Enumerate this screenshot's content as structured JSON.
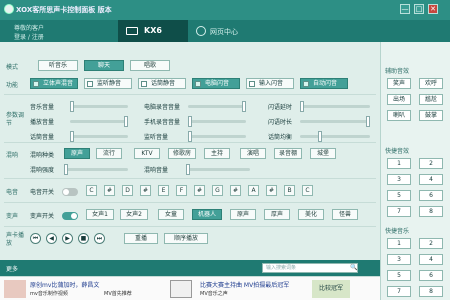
{
  "window": {
    "title": "XOX客所思声卡控制面板 版本",
    "min": "—",
    "max": "□",
    "close": "✕"
  },
  "user": {
    "line1": "尊敬的客户",
    "line2": "登录 / 注册"
  },
  "tabs": {
    "device": "KX6",
    "center": "网页中心"
  },
  "mode": {
    "label": "模式",
    "options": [
      "听音乐",
      "聊天",
      "唱歌"
    ],
    "active": 1
  },
  "function": {
    "label": "功能",
    "items": [
      {
        "label": "立体声混音",
        "on": true
      },
      {
        "label": "监听静音",
        "on": false
      },
      {
        "label": "话筒静音",
        "on": false
      },
      {
        "label": "电脑闪音",
        "on": true
      },
      {
        "label": "输入闪音",
        "on": false
      },
      {
        "label": "自动闪音",
        "on": true
      }
    ]
  },
  "params": {
    "label": "参数调节",
    "rows": [
      {
        "a": "音乐音量",
        "b": "电脑录音音量",
        "c": "闪语延时"
      },
      {
        "a": "播放音量",
        "b": "手机录音音量",
        "c": "闪语时长"
      },
      {
        "a": "话筒音量",
        "b": "监听音量",
        "c": "话筒均衡"
      }
    ]
  },
  "reverb": {
    "label": "混响",
    "type_label": "混响种类",
    "types": [
      "原声",
      "流行",
      "KTV",
      "修歌房",
      "主持",
      "演唱",
      "录音棚",
      "城堡"
    ],
    "active": 0,
    "strength_label": "混响强度",
    "eq_label": "混响音量"
  },
  "electric": {
    "label": "电音",
    "switch_label": "电音开关",
    "keys": [
      "C",
      "D",
      "E",
      "F",
      "G",
      "A",
      "B",
      "C"
    ],
    "sharps": [
      "#",
      "#",
      "#",
      "#",
      "#"
    ]
  },
  "voice": {
    "label": "变声",
    "switch_label": "变声开关",
    "options": [
      "女声1",
      "女声2",
      "女童",
      "机器人",
      "原声",
      "厚声",
      "美化",
      "怪兽"
    ],
    "active": 3
  },
  "player": {
    "label": "声卡播放",
    "repeat": "重播",
    "order": "顺序播放"
  },
  "footer": {
    "left": "更多",
    "search_placeholder": "输入搜索词条"
  },
  "right": {
    "assist_title": "辅助音效",
    "assist": [
      "笑声",
      "欢呼",
      "出场",
      "尴尬",
      "喇叭",
      "鼓掌",
      "嘘声",
      "哈哈"
    ],
    "quick1_title": "快捷音效",
    "quick1": [
      "1",
      "2",
      "3",
      "4",
      "5",
      "6",
      "7",
      "8"
    ],
    "quick2_title": "快捷音乐",
    "quick2": [
      "1",
      "2",
      "3",
      "4",
      "5",
      "6",
      "7",
      "8"
    ]
  },
  "ads": {
    "a1": "原创mv比蒲加时，薛昌文",
    "a2": "比赛大赛主持曲 MV拍摄最后冠军",
    "a3": "mv音乐制作视频",
    "a4": "MV首先推荐",
    "a5": "MV音乐之声",
    "a6": "比较冠军"
  }
}
